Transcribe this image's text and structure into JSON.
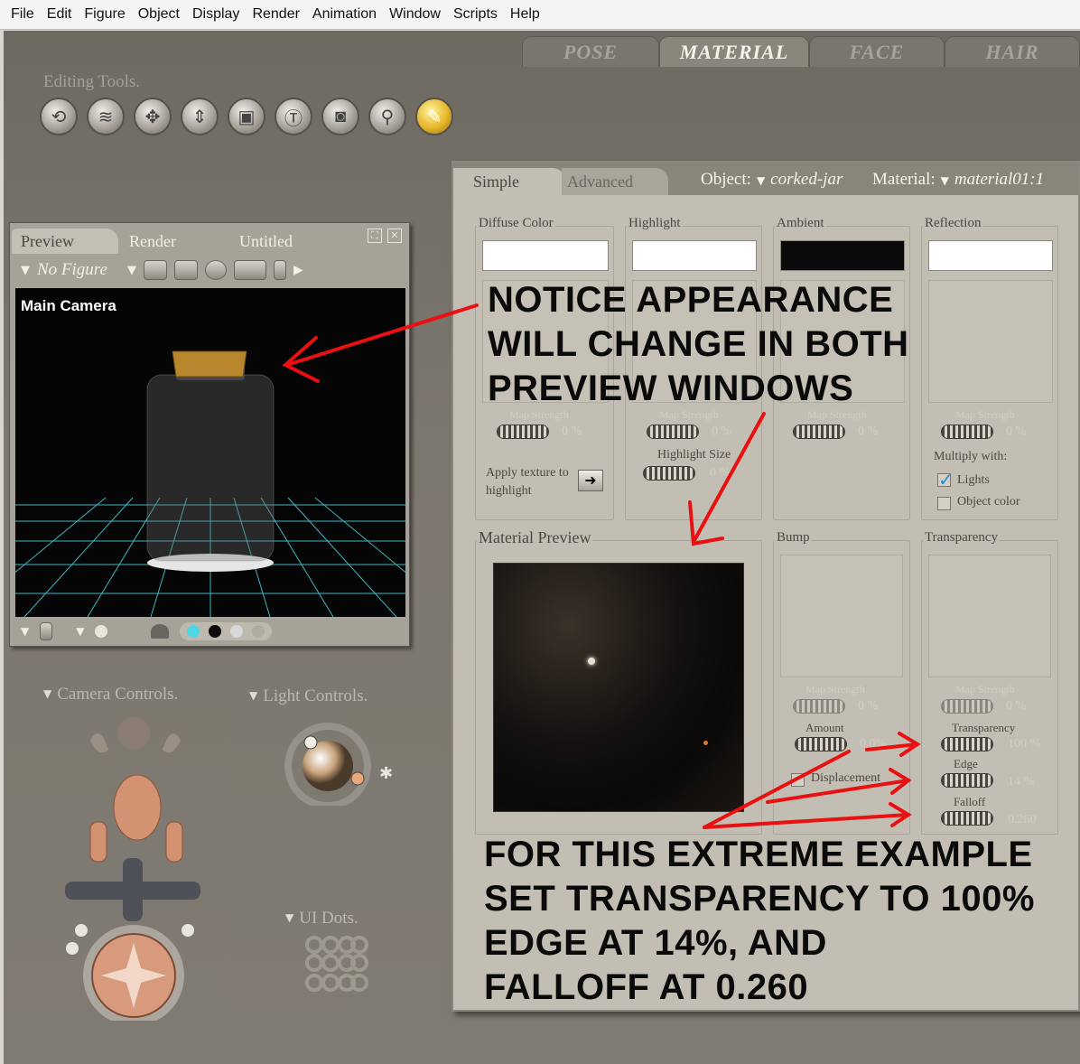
{
  "menu": [
    "File",
    "Edit",
    "Figure",
    "Object",
    "Display",
    "Render",
    "Animation",
    "Window",
    "Scripts",
    "Help"
  ],
  "rooms": [
    {
      "label": "POSE",
      "active": false
    },
    {
      "label": "MATERIAL",
      "active": true
    },
    {
      "label": "FACE",
      "active": false
    },
    {
      "label": "HAIR",
      "active": false
    }
  ],
  "editing_tools": {
    "label": "Editing Tools.",
    "tools": [
      "rotate-icon",
      "twist-icon",
      "translate-icon",
      "translate-in-out-icon",
      "scale-icon",
      "taper-icon",
      "chain-break-icon",
      "color-icon",
      "grouping-icon"
    ],
    "icons": [
      "⟲",
      "≋",
      "✥",
      "⇕",
      "▣",
      "Ⓣ",
      "◙",
      "⚲",
      "✎"
    ]
  },
  "preview_window": {
    "tabs": [
      "Preview",
      "Render",
      "Untitled"
    ],
    "figure_select": "No Figure",
    "camera_label": "Main Camera",
    "display_dots": [
      "#4fd6e0",
      "#0b0b0b",
      "#d8d8d8",
      "#b0aca3"
    ]
  },
  "controls": {
    "camera": "Camera Controls.",
    "light": "Light Controls.",
    "ui_dots": "UI Dots."
  },
  "material_panel": {
    "tabs": [
      "Simple",
      "Advanced"
    ],
    "object_label": "Object:",
    "object_value": "corked-jar",
    "material_label": "Material:",
    "material_value": "material01:1",
    "diffuse": {
      "title": "Diffuse Color",
      "color": "#ffffff",
      "map_strength": "Map Strength",
      "value": "0 %"
    },
    "highlight": {
      "title": "Highlight",
      "color": "#ffffff",
      "map_strength": "Map Strength",
      "value": "0 %",
      "size_label": "Highlight Size",
      "size_value": "0 %"
    },
    "ambient": {
      "title": "Ambient",
      "color": "#0a0a0a",
      "map_strength": "Map Strength",
      "value": "0 %"
    },
    "reflection": {
      "title": "Reflection",
      "color": "#ffffff",
      "map_strength": "Map Strength",
      "value": "0 %",
      "multiply_label": "Multiply with:",
      "lights_label": "Lights",
      "lights_checked": true,
      "object_color_label": "Object color",
      "object_color_checked": false
    },
    "apply_texture": "Apply texture to highlight",
    "material_preview": "Material Preview",
    "bump": {
      "title": "Bump",
      "map_strength": "Map Strength",
      "amount_label": "Amount",
      "amount_value": "0.0%",
      "displacement_label": "Displacement",
      "value": "0 %"
    },
    "transparency": {
      "title": "Transparency",
      "map_strength": "Map Strength",
      "value": "0 %",
      "transparency_label": "Transparency",
      "transparency_value": "100 %",
      "edge_label": "Edge",
      "edge_value": "14 %",
      "falloff_label": "Falloff",
      "falloff_value": "0.260"
    }
  },
  "annotations": {
    "top": [
      "NOTICE APPEARANCE",
      "WILL CHANGE IN BOTH",
      "PREVIEW WINDOWS"
    ],
    "bottom": [
      "FOR THIS EXTREME EXAMPLE",
      "SET TRANSPARENCY TO 100%",
      "EDGE AT 14%, AND",
      "FALLOFF AT 0.260"
    ],
    "arrow_color": "#e81010"
  }
}
